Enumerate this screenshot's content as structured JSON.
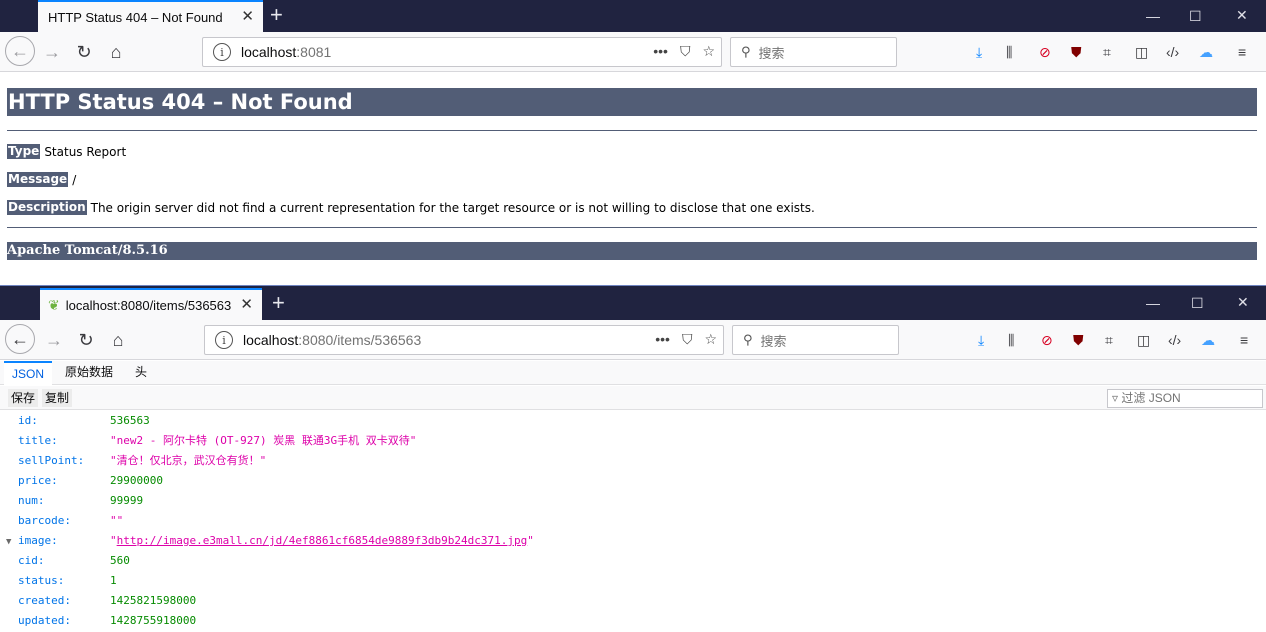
{
  "window1": {
    "tab_title": "HTTP Status 404 – Not Found",
    "url_host": "localhost",
    "url_rest": ":8081",
    "search_placeholder": "搜索"
  },
  "tomcat": {
    "heading": "HTTP Status 404 – Not Found",
    "type_label": "Type",
    "type_value": "Status Report",
    "message_label": "Message",
    "message_value": "/",
    "description_label": "Description",
    "description_value": "The origin server did not find a current representation for the target resource or is not willing to disclose that one exists.",
    "footer": "Apache Tomcat/8.5.16"
  },
  "window2": {
    "tab_title": "localhost:8080/items/536563",
    "url_host": "localhost",
    "url_rest": ":8080/items/536563",
    "search_placeholder": "搜索"
  },
  "jsonviewer": {
    "tabs": [
      "JSON",
      "原始数据",
      "头"
    ],
    "save": "保存",
    "copy": "复制",
    "filter_placeholder": "过滤 JSON",
    "rows": [
      {
        "key": "id:",
        "value": "536563",
        "type": "num"
      },
      {
        "key": "title:",
        "value": "\"new2 - 阿尔卡特 (OT-927) 炭黑 联通3G手机 双卡双待\"",
        "type": "str"
      },
      {
        "key": "sellPoint:",
        "value": "\"清仓！仅北京，武汉仓有货！\"",
        "type": "str"
      },
      {
        "key": "price:",
        "value": "29900000",
        "type": "num"
      },
      {
        "key": "num:",
        "value": "99999",
        "type": "num"
      },
      {
        "key": "barcode:",
        "value": "\"\"",
        "type": "str"
      },
      {
        "key": "image:",
        "value": "http://image.e3mall.cn/jd/4ef8861cf6854de9889f3db9b24dc371.jpg",
        "type": "link"
      },
      {
        "key": "cid:",
        "value": "560",
        "type": "num"
      },
      {
        "key": "status:",
        "value": "1",
        "type": "num"
      },
      {
        "key": "created:",
        "value": "1425821598000",
        "type": "num"
      },
      {
        "key": "updated:",
        "value": "1428755918000",
        "type": "num"
      }
    ]
  },
  "colors": {
    "tabstrip": "#202340",
    "tomcat_bar": "#525d76",
    "json_key": "#0074e8",
    "json_number": "#058b00",
    "json_string": "#dd00a9"
  }
}
